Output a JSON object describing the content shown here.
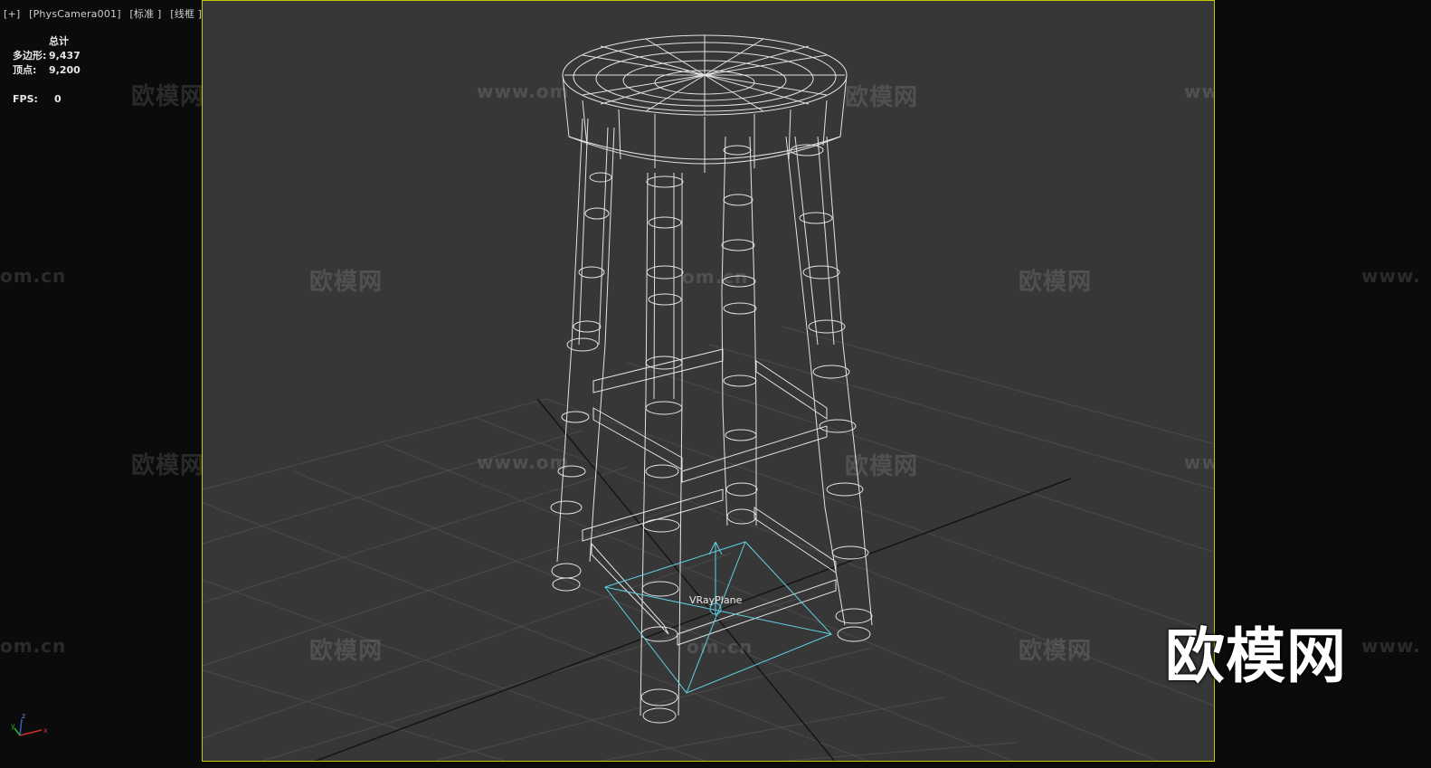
{
  "viewport": {
    "label_parts": [
      "[+]",
      "[PhysCamera001]",
      "[标准 ]",
      "[线框 ]"
    ],
    "border_color": "#c8c800",
    "background": "#373737"
  },
  "stats": {
    "title": "总计",
    "polygons_label": "多边形:",
    "polygons_value": "9,437",
    "vertices_label": "顶点:",
    "vertices_value": "9,200",
    "fps_label": "FPS:",
    "fps_value": "0"
  },
  "scene": {
    "object_label": "VRayPlane",
    "wire_color": "#ffffff",
    "plane_color": "#5fd0e0",
    "grid_color": "#4a4a4a"
  },
  "axis_gizmo": {
    "x": "x",
    "y": "y",
    "z": "z"
  },
  "watermarks": {
    "logo_text": "欧模网",
    "url_text": "www.om.cn",
    "url_short": "om.cn",
    "url_prefix": "www.",
    "url_partial": "www.om"
  },
  "brand": "欧模网"
}
